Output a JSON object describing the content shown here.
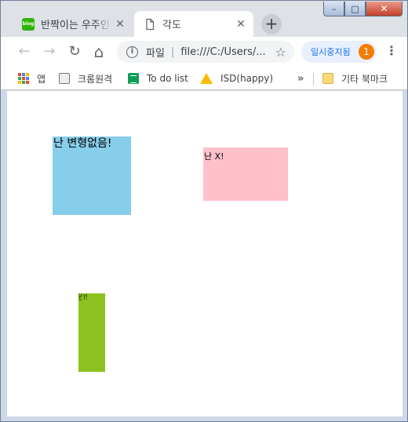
{
  "browser": {
    "tabs": [
      {
        "title": "반짝이는 우주인",
        "favicon_text": "blog",
        "active": false
      },
      {
        "title": "각도",
        "active": true
      }
    ],
    "new_tab_symbol": "+",
    "window_controls": {
      "minimize": "–",
      "maximize": "□",
      "close": "✕"
    }
  },
  "toolbar": {
    "back_symbol": "←",
    "forward_symbol": "→",
    "reload_symbol": "↻",
    "home_symbol": "⌂",
    "omnibox": {
      "info_symbol": "i",
      "scheme_label": "파일",
      "url": "file:///C:/Users/..."
    },
    "star_symbol": "☆",
    "paused_label": "일시중지됨",
    "paused_badge": "1",
    "menu_symbol": "⋮"
  },
  "bookmarks": {
    "items": [
      {
        "label": "앱",
        "icon": "apps-grid-icon"
      },
      {
        "label": "크롬원격",
        "icon": "remote-desktop-icon"
      },
      {
        "label": "To do list",
        "icon": "sheets-icon"
      },
      {
        "label": "ISD(happy)",
        "icon": "drive-icon"
      }
    ],
    "more_symbol": "»",
    "other_label": "기타 북마크"
  },
  "page": {
    "box_blue_text": "난 변형없음!",
    "box_pink_text": "난 X!",
    "box_green_text": "난 Y!"
  },
  "colors": {
    "box_blue": "#87ceeb",
    "box_pink": "#ffc0cb",
    "box_green": "#8bc21f",
    "paused_badge": "#f57c00"
  }
}
